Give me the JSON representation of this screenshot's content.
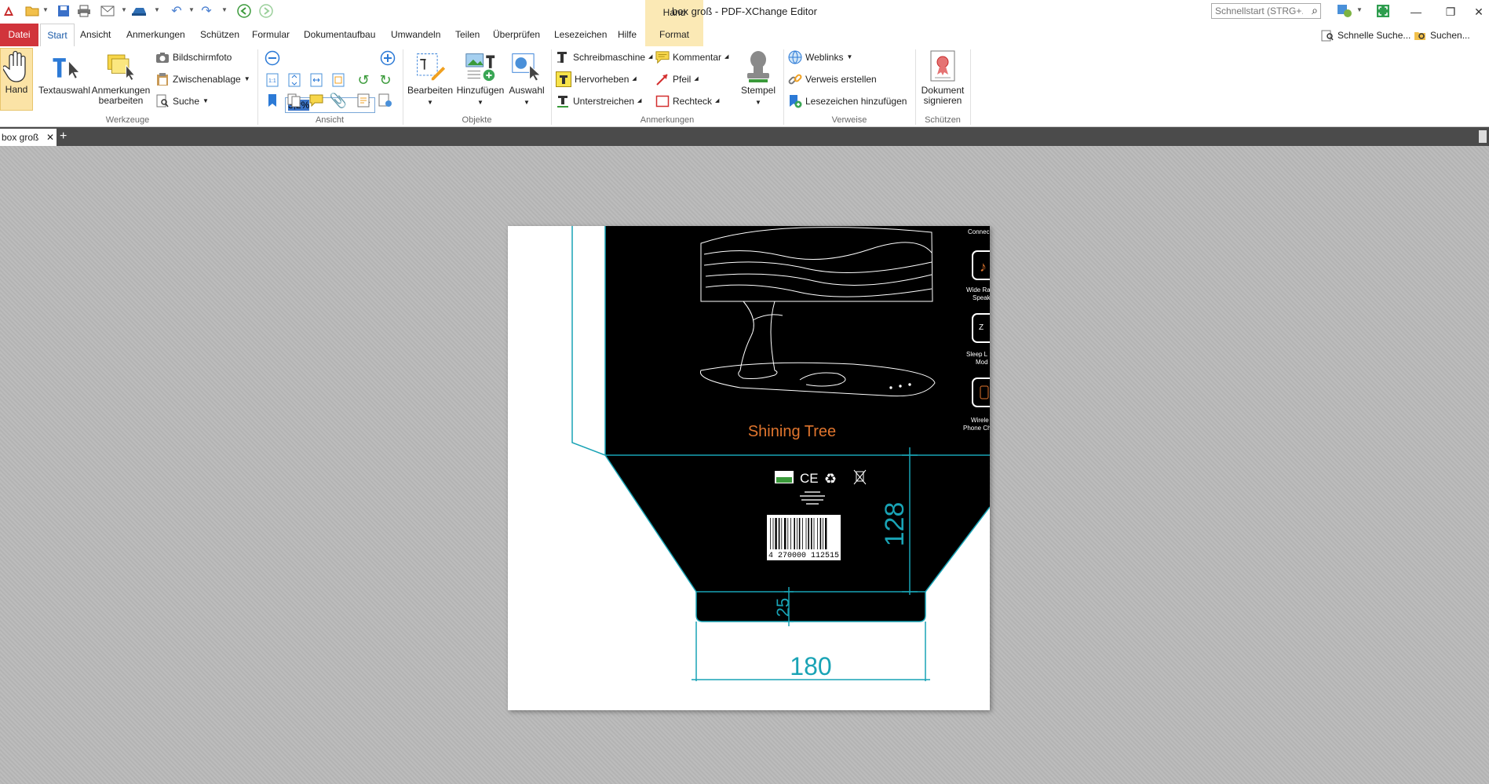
{
  "window": {
    "title": "box groß - PDF-XChange Editor",
    "context_tab_group": "Hand"
  },
  "quick_launch": {
    "placeholder": "Schnellstart (STRG+.)"
  },
  "menu": {
    "tabs": [
      "Datei",
      "Start",
      "Ansicht",
      "Anmerkungen",
      "Schützen",
      "Formular",
      "Dokumentaufbau",
      "Umwandeln",
      "Teilen",
      "Überprüfen",
      "Lesezeichen",
      "Hilfe",
      "Format"
    ],
    "right_items": [
      "Schnelle Suche...",
      "Suchen..."
    ]
  },
  "ribbon": {
    "werkzeuge": {
      "label": "Werkzeuge",
      "hand": "Hand",
      "textauswahl": "Textauswahl",
      "anmerkungen_bearbeiten": "Anmerkungen bearbeiten",
      "bildschirmfoto": "Bildschirmfoto",
      "zwischenablage": "Zwischenablage",
      "suche": "Suche"
    },
    "ansicht": {
      "label": "Ansicht",
      "zoom": "3,2%"
    },
    "objekte": {
      "label": "Objekte",
      "bearbeiten": "Bearbeiten",
      "hinzufuegen": "Hinzufügen",
      "auswahl": "Auswahl"
    },
    "anmerkungen": {
      "label": "Anmerkungen",
      "schreibmaschine": "Schreibmaschine",
      "hervorheben": "Hervorheben",
      "unterstreichen": "Unterstreichen",
      "kommentar": "Kommentar",
      "pfeil": "Pfeil",
      "rechteck": "Rechteck",
      "stempel": "Stempel"
    },
    "verweise": {
      "label": "Verweise",
      "weblinks": "Weblinks",
      "verweis_erstellen": "Verweis erstellen",
      "lesezeichen_hinzufuegen": "Lesezeichen hinzufügen"
    },
    "schuetzen": {
      "label": "Schützen",
      "dokument_signieren": "Dokument signieren"
    }
  },
  "document_tab": {
    "name": "box groß"
  },
  "document": {
    "product_name": "Shining Tree",
    "side_header": "Connec",
    "features": [
      "Wide Ra",
      "Speak",
      "Sleep L",
      "Mod",
      "Wirele",
      "Phone Ch"
    ],
    "dimensions": {
      "width": "180",
      "height": "128",
      "depth": "25"
    },
    "barcode": "4 270000 112515",
    "colors": {
      "cutline": "#19a3b5",
      "product_name": "#e0752e",
      "box_fill": "#000000"
    }
  },
  "colors": {
    "datei_tab": "#d1343b",
    "context_tab": "#fbe9b5",
    "workspace": "#b9b9b9",
    "doc_bar": "#4b4b4b"
  }
}
